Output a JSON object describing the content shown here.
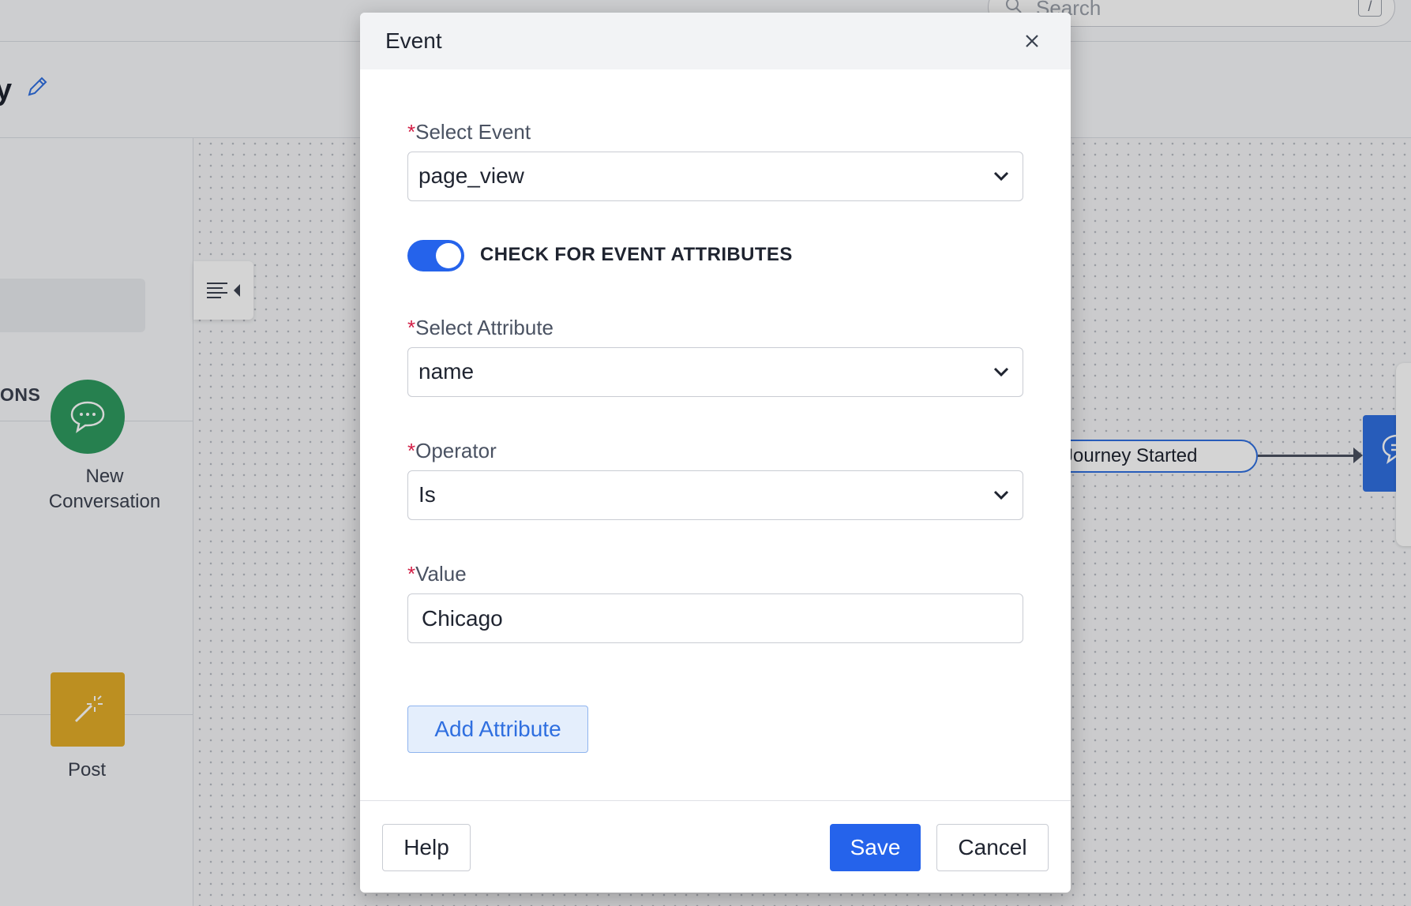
{
  "topbar": {
    "search_placeholder": "Search",
    "shortcut_key": "/"
  },
  "subheader": {
    "journey_name_fragment": "y"
  },
  "left_panel": {
    "section_label_fragment": "ONS",
    "tiles": [
      {
        "label": "New Conversation",
        "icon": "chat-bubble-icon",
        "color": "#2e9a5f"
      },
      {
        "label": "Post",
        "icon": "magic-wand-icon",
        "color": "#e3ad28"
      }
    ]
  },
  "canvas": {
    "start_node_label": "Journey Started",
    "next_node_icon": "chat-icon",
    "next_node_color": "#2f6fe0"
  },
  "modal": {
    "title": "Event",
    "select_event": {
      "label": "Select Event",
      "value": "page_view"
    },
    "toggle": {
      "label": "CHECK FOR EVENT ATTRIBUTES",
      "on": true
    },
    "select_attribute": {
      "label": "Select Attribute",
      "value": "name"
    },
    "operator": {
      "label": "Operator",
      "value": "Is"
    },
    "value_field": {
      "label": "Value",
      "value": "Chicago"
    },
    "required_marker": "*",
    "add_attribute_label": "Add Attribute",
    "footer": {
      "help_label": "Help",
      "save_label": "Save",
      "cancel_label": "Cancel"
    }
  },
  "colors": {
    "accent": "#2563eb",
    "required": "#d21d45"
  }
}
